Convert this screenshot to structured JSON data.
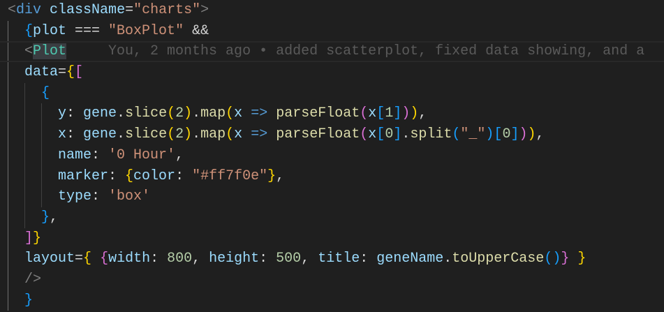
{
  "editor": {
    "blame": "You, 2 months ago • added scatterplot, fixed data showing, and a",
    "current_line": 2,
    "lines": [
      {
        "indent": 0,
        "tokens": [
          {
            "t": "<",
            "c": "punct"
          },
          {
            "t": "div",
            "c": "tag"
          },
          {
            "t": " ",
            "c": "text"
          },
          {
            "t": "className",
            "c": "attr"
          },
          {
            "t": "=",
            "c": "text"
          },
          {
            "t": "\"charts\"",
            "c": "str"
          },
          {
            "t": ">",
            "c": "punct"
          }
        ]
      },
      {
        "indent": 1,
        "tokens": [
          {
            "t": "{",
            "c": "b3"
          },
          {
            "t": "plot",
            "c": "attr"
          },
          {
            "t": " === ",
            "c": "text"
          },
          {
            "t": "\"BoxPlot\"",
            "c": "str"
          },
          {
            "t": " &&",
            "c": "text"
          }
        ]
      },
      {
        "indent": 1,
        "tokens": [
          {
            "t": "<",
            "c": "punct"
          },
          {
            "t": "Plot",
            "c": "comp hl"
          }
        ]
      },
      {
        "indent": 1,
        "tokens": [
          {
            "t": "data",
            "c": "attr"
          },
          {
            "t": "=",
            "c": "text"
          },
          {
            "t": "{",
            "c": "b1"
          },
          {
            "t": "[",
            "c": "b2"
          }
        ]
      },
      {
        "indent": 2,
        "tokens": [
          {
            "t": "{",
            "c": "b3"
          }
        ]
      },
      {
        "indent": 3,
        "tokens": [
          {
            "t": "y",
            "c": "attr"
          },
          {
            "t": ": ",
            "c": "text"
          },
          {
            "t": "gene",
            "c": "attr"
          },
          {
            "t": ".",
            "c": "text"
          },
          {
            "t": "slice",
            "c": "fn"
          },
          {
            "t": "(",
            "c": "b1"
          },
          {
            "t": "2",
            "c": "num"
          },
          {
            "t": ")",
            "c": "b1"
          },
          {
            "t": ".",
            "c": "text"
          },
          {
            "t": "map",
            "c": "fn"
          },
          {
            "t": "(",
            "c": "b1"
          },
          {
            "t": "x",
            "c": "attr"
          },
          {
            "t": " ",
            "c": "text"
          },
          {
            "t": "=>",
            "c": "kw"
          },
          {
            "t": " ",
            "c": "text"
          },
          {
            "t": "parseFloat",
            "c": "fn"
          },
          {
            "t": "(",
            "c": "b2"
          },
          {
            "t": "x",
            "c": "attr"
          },
          {
            "t": "[",
            "c": "b3"
          },
          {
            "t": "1",
            "c": "num"
          },
          {
            "t": "]",
            "c": "b3"
          },
          {
            "t": ")",
            "c": "b2"
          },
          {
            "t": ")",
            "c": "b1"
          },
          {
            "t": ",",
            "c": "text"
          }
        ]
      },
      {
        "indent": 3,
        "tokens": [
          {
            "t": "x",
            "c": "attr"
          },
          {
            "t": ": ",
            "c": "text"
          },
          {
            "t": "gene",
            "c": "attr"
          },
          {
            "t": ".",
            "c": "text"
          },
          {
            "t": "slice",
            "c": "fn"
          },
          {
            "t": "(",
            "c": "b1"
          },
          {
            "t": "2",
            "c": "num"
          },
          {
            "t": ")",
            "c": "b1"
          },
          {
            "t": ".",
            "c": "text"
          },
          {
            "t": "map",
            "c": "fn"
          },
          {
            "t": "(",
            "c": "b1"
          },
          {
            "t": "x",
            "c": "attr"
          },
          {
            "t": " ",
            "c": "text"
          },
          {
            "t": "=>",
            "c": "kw"
          },
          {
            "t": " ",
            "c": "text"
          },
          {
            "t": "parseFloat",
            "c": "fn"
          },
          {
            "t": "(",
            "c": "b2"
          },
          {
            "t": "x",
            "c": "attr"
          },
          {
            "t": "[",
            "c": "b3"
          },
          {
            "t": "0",
            "c": "num"
          },
          {
            "t": "]",
            "c": "b3"
          },
          {
            "t": ".",
            "c": "text"
          },
          {
            "t": "split",
            "c": "fn"
          },
          {
            "t": "(",
            "c": "b3"
          },
          {
            "t": "\"_\"",
            "c": "str"
          },
          {
            "t": ")",
            "c": "b3"
          },
          {
            "t": "[",
            "c": "b3"
          },
          {
            "t": "0",
            "c": "num"
          },
          {
            "t": "]",
            "c": "b3"
          },
          {
            "t": ")",
            "c": "b2"
          },
          {
            "t": ")",
            "c": "b1"
          },
          {
            "t": ",",
            "c": "text"
          }
        ]
      },
      {
        "indent": 3,
        "tokens": [
          {
            "t": "name",
            "c": "attr"
          },
          {
            "t": ": ",
            "c": "text"
          },
          {
            "t": "'0 Hour'",
            "c": "str"
          },
          {
            "t": ",",
            "c": "text"
          }
        ]
      },
      {
        "indent": 3,
        "tokens": [
          {
            "t": "marker",
            "c": "attr"
          },
          {
            "t": ": ",
            "c": "text"
          },
          {
            "t": "{",
            "c": "b1"
          },
          {
            "t": "color",
            "c": "attr"
          },
          {
            "t": ": ",
            "c": "text"
          },
          {
            "t": "\"#ff7f0e\"",
            "c": "str"
          },
          {
            "t": "}",
            "c": "b1"
          },
          {
            "t": ",",
            "c": "text"
          }
        ]
      },
      {
        "indent": 3,
        "tokens": [
          {
            "t": "type",
            "c": "attr"
          },
          {
            "t": ": ",
            "c": "text"
          },
          {
            "t": "'box'",
            "c": "str"
          }
        ]
      },
      {
        "indent": 2,
        "tokens": [
          {
            "t": "}",
            "c": "b3"
          },
          {
            "t": ",",
            "c": "text"
          }
        ]
      },
      {
        "indent": 1,
        "tokens": [
          {
            "t": "]",
            "c": "b2"
          },
          {
            "t": "}",
            "c": "b1"
          }
        ]
      },
      {
        "indent": 1,
        "tokens": [
          {
            "t": "layout",
            "c": "attr"
          },
          {
            "t": "=",
            "c": "text"
          },
          {
            "t": "{",
            "c": "b1"
          },
          {
            "t": " ",
            "c": "text"
          },
          {
            "t": "{",
            "c": "b2"
          },
          {
            "t": "width",
            "c": "attr"
          },
          {
            "t": ": ",
            "c": "text"
          },
          {
            "t": "800",
            "c": "num"
          },
          {
            "t": ", ",
            "c": "text"
          },
          {
            "t": "height",
            "c": "attr"
          },
          {
            "t": ": ",
            "c": "text"
          },
          {
            "t": "500",
            "c": "num"
          },
          {
            "t": ", ",
            "c": "text"
          },
          {
            "t": "title",
            "c": "attr"
          },
          {
            "t": ": ",
            "c": "text"
          },
          {
            "t": "geneName",
            "c": "attr"
          },
          {
            "t": ".",
            "c": "text"
          },
          {
            "t": "toUpperCase",
            "c": "fn"
          },
          {
            "t": "(",
            "c": "b3"
          },
          {
            "t": ")",
            "c": "b3"
          },
          {
            "t": "}",
            "c": "b2"
          },
          {
            "t": " ",
            "c": "text"
          },
          {
            "t": "}",
            "c": "b1"
          }
        ]
      },
      {
        "indent": 1,
        "tokens": [
          {
            "t": "/>",
            "c": "punct"
          }
        ]
      },
      {
        "indent": 1,
        "tokens": [
          {
            "t": "}",
            "c": "b3"
          }
        ]
      }
    ]
  }
}
